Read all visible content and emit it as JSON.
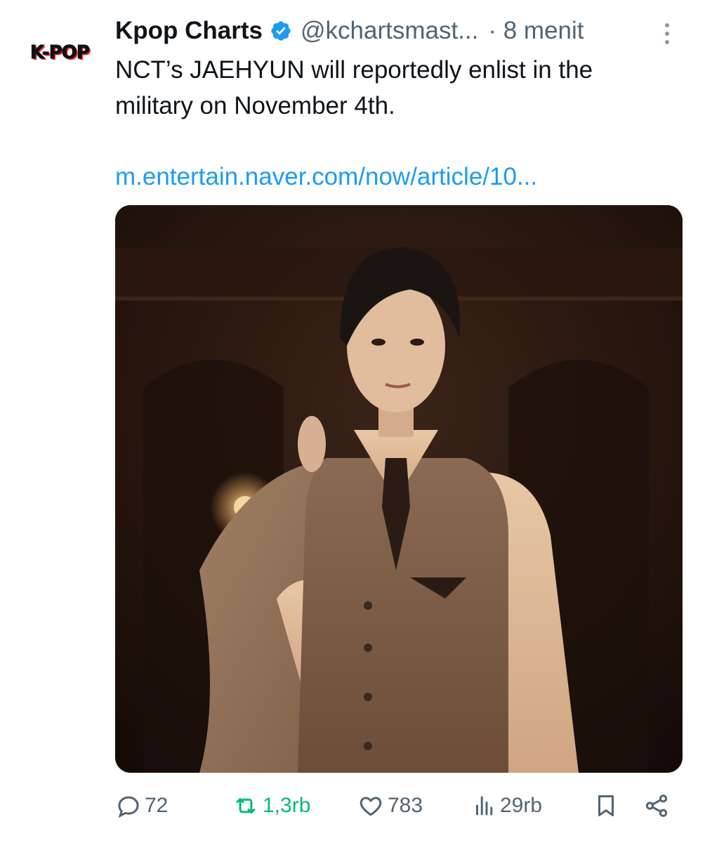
{
  "tweet": {
    "avatar_text": "K-POP",
    "author_name": "Kpop Charts",
    "handle": "@kchartsmast...",
    "time": "· 8 menit",
    "text": "NCT’s JAEHYUN will reportedly enlist in the military on November 4th.",
    "link": "m.entertain.naver.com/now/article/10...",
    "accent_color": "#1d9bf0",
    "retweet_color": "#00ba7c"
  },
  "actions": {
    "reply": {
      "icon": "reply-icon",
      "count": "72"
    },
    "retweet": {
      "icon": "retweet-icon",
      "count": "1,3rb"
    },
    "like": {
      "icon": "heart-icon",
      "count": "783"
    },
    "views": {
      "icon": "views-icon",
      "count": "29rb"
    },
    "bookmark": {
      "icon": "bookmark-icon"
    },
    "share": {
      "icon": "share-icon"
    }
  }
}
